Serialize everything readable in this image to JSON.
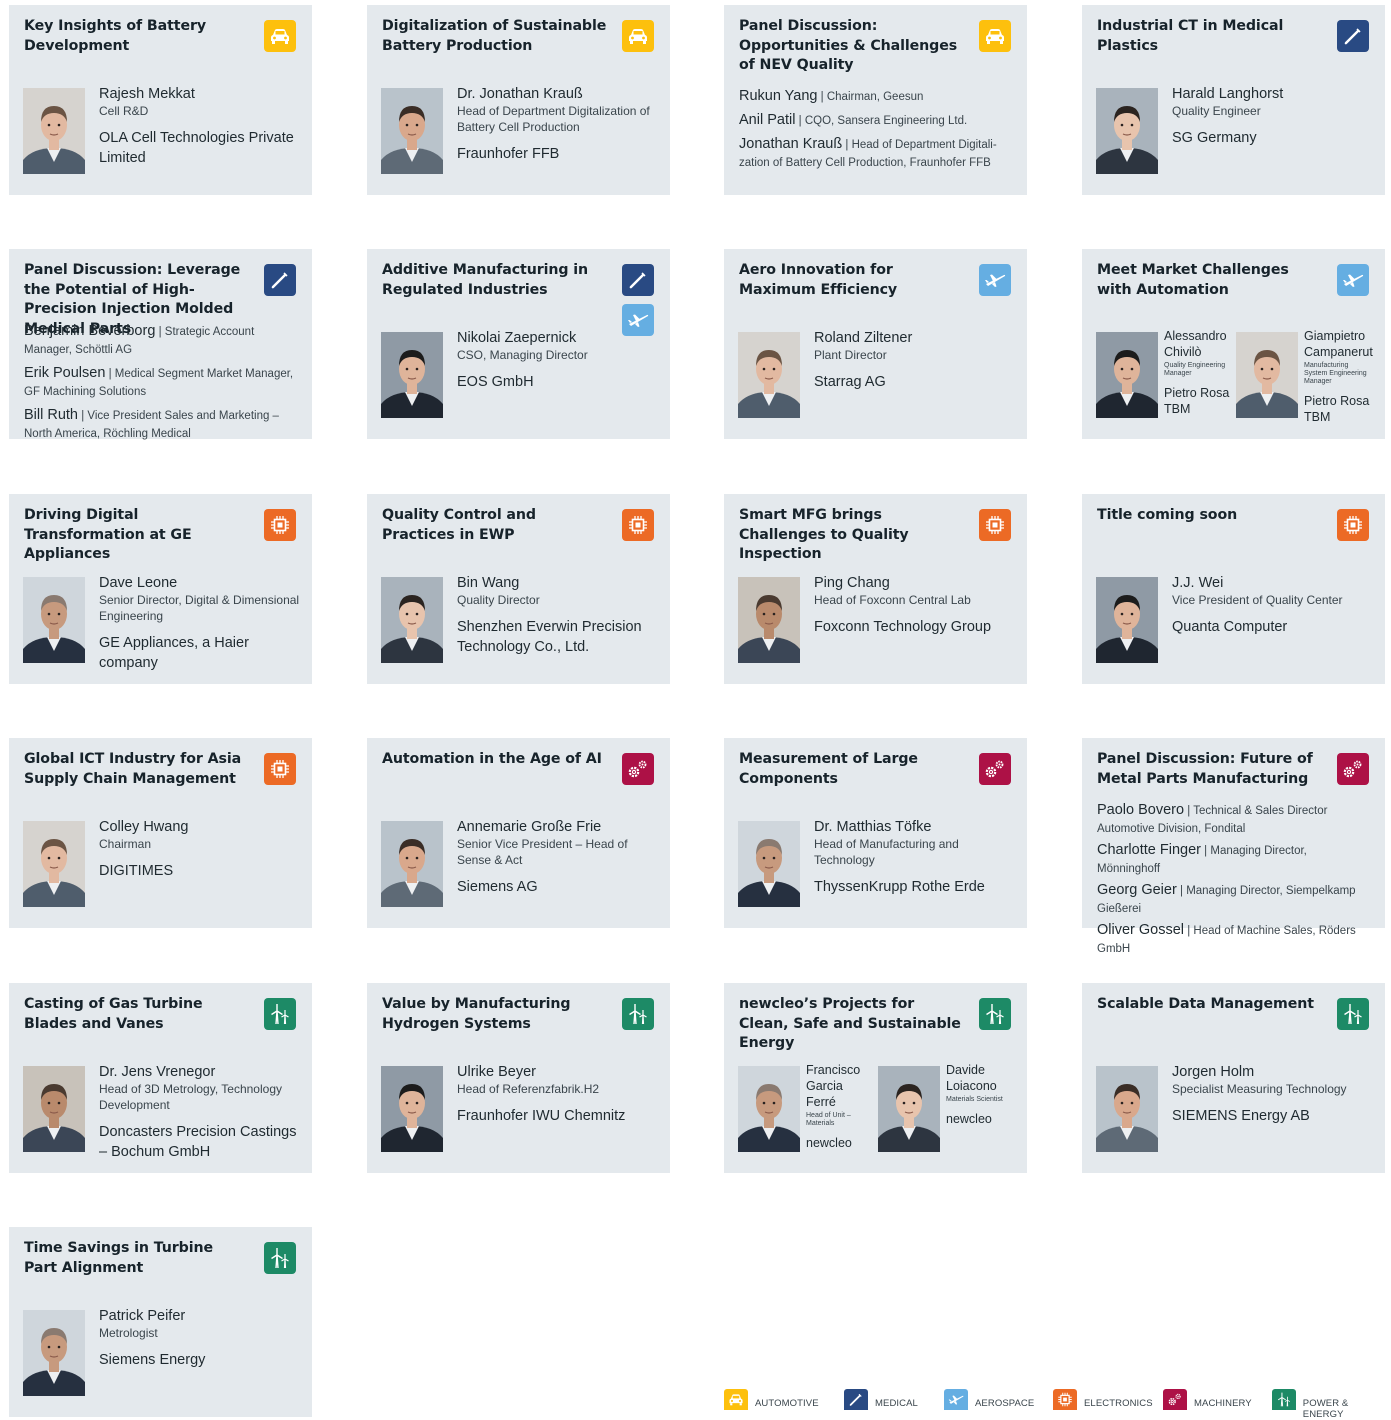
{
  "colors": {
    "automotive": "#fdc00d",
    "medical": "#294a83",
    "aerospace": "#65aee2",
    "electronics": "#ec6a25",
    "machinery": "#ad1146",
    "energy": "#1d8a66",
    "card_bg": "#e4e9ed"
  },
  "cards": [
    {
      "title": "Key Insights of Battery Development",
      "icons": [
        "automotive"
      ],
      "name": "Rajesh Mekkat",
      "role": "Cell R&D",
      "org": "OLA Cell Technologies Private Limited"
    },
    {
      "title": "Digitalization of Sustainable Battery Production",
      "icons": [
        "automotive"
      ],
      "name": "Dr. Jonathan Krauß",
      "role": "Head of Department Digitalization of Battery Cell Production",
      "org": "Fraunhofer FFB"
    },
    {
      "title": "Panel Discussion: Opportunities & Challenges of NEV Quality",
      "icons": [
        "automotive"
      ],
      "panel": [
        {
          "name": "Rukun Yang",
          "role": "Chairman, Geesun"
        },
        {
          "name": "Anil Patil",
          "role": "CQO, Sansera Engineering Ltd."
        },
        {
          "name": "Jonathan Krauß",
          "role": "Head of Department Digitali-zation of Battery Cell Production, Fraunhofer FFB"
        }
      ]
    },
    {
      "title": "Industrial CT in Medical Plastics",
      "icons": [
        "medical"
      ],
      "name": "Harald Langhorst",
      "role": "Quality Engineer",
      "org": "SG Germany"
    },
    {
      "title": "Panel Discussion: Leverage the Potential of High-Precision Injection Molded Medical Parts",
      "icons": [
        "medical"
      ],
      "panel": [
        {
          "name": "Benjamin Beverborg",
          "role": "Strategic Account Manager, Schöttli AG"
        },
        {
          "name": "Erik Poulsen",
          "role": "Medical Segment Market Manager, GF Machining Solutions"
        },
        {
          "name": "Bill Ruth",
          "role": "Vice President Sales and Marketing – North America, Röchling Medical"
        }
      ]
    },
    {
      "title": "Additive Manufacturing in Regulated Industries",
      "icons": [
        "medical",
        "aerospace"
      ],
      "name": "Nikolai Zaepernick",
      "role": "CSO, Managing Director",
      "org": "EOS GmbH"
    },
    {
      "title": "Aero Innovation for Maximum Efficiency",
      "icons": [
        "aerospace"
      ],
      "name": "Roland Ziltener",
      "role": "Plant Director",
      "org": "Starrag AG"
    },
    {
      "title": "Meet Market Challenges with Automation",
      "icons": [
        "aerospace"
      ],
      "duo": [
        {
          "name": "Alessandro Chivilò",
          "role": "Quality Engineering Manager",
          "org": "Pietro Rosa TBM"
        },
        {
          "name": "Giampietro Campanerut",
          "role": "Manufacturing System Engineering Manager",
          "org": "Pietro Rosa TBM"
        }
      ]
    },
    {
      "title": "Driving Digital Transformation at GE Appliances",
      "icons": [
        "electronics"
      ],
      "name": "Dave Leone",
      "role": "Senior Director, Digital & Dimensional Engineering",
      "org": "GE Appliances, a Haier company"
    },
    {
      "title": "Quality Control and Practices in EWP",
      "icons": [
        "electronics"
      ],
      "name": "Bin Wang",
      "role": "Quality Director",
      "org": "Shenzhen Everwin Precision Technology Co., Ltd."
    },
    {
      "title": "Smart MFG brings Challenges to Quality Inspection",
      "icons": [
        "electronics"
      ],
      "name": "Ping Chang",
      "role": "Head of Foxconn Central Lab",
      "org": "Foxconn Technology Group"
    },
    {
      "title": "Title coming soon",
      "icons": [
        "electronics"
      ],
      "name": "J.J. Wei",
      "role": "Vice President of Quality Center",
      "org": "Quanta Computer"
    },
    {
      "title": "Global ICT Industry for Asia Supply Chain Management",
      "icons": [
        "electronics"
      ],
      "name": "Colley Hwang",
      "role": "Chairman",
      "org": "DIGITIMES"
    },
    {
      "title": "Automation in the Age of AI",
      "icons": [
        "machinery"
      ],
      "name": "Annemarie Große Frie",
      "role": "Senior Vice President – Head of Sense & Act",
      "org": "Siemens AG"
    },
    {
      "title": "Measurement of Large Components",
      "icons": [
        "machinery"
      ],
      "name": "Dr. Matthias Töfke",
      "role": "Head of Manufacturing and Technology",
      "org": "ThyssenKrupp Rothe Erde"
    },
    {
      "title": "Panel Discussion: Future of Metal Parts Manufacturing",
      "icons": [
        "machinery"
      ],
      "panel": [
        {
          "name": "Paolo Bovero",
          "role": "Technical & Sales Director Automotive Division, Fondital"
        },
        {
          "name": "Charlotte Finger",
          "role": "Managing Director, Mönninghoff"
        },
        {
          "name": "Georg Geier",
          "role": "Managing Director, Siempelkamp Gießerei"
        },
        {
          "name": "Oliver Gossel",
          "role": "Head of Machine Sales, Röders GmbH"
        }
      ]
    },
    {
      "title": "Casting of Gas Turbine Blades and Vanes",
      "icons": [
        "energy"
      ],
      "name": "Dr. Jens Vrenegor",
      "role": "Head of 3D Metrology, Technology Development",
      "org": "Doncasters Precision Castings – Bochum GmbH"
    },
    {
      "title": "Value by Manufacturing Hydrogen Systems",
      "icons": [
        "energy"
      ],
      "name": "Ulrike Beyer",
      "role": "Head of Referenzfabrik.H2",
      "org": "Fraunhofer IWU Chemnitz"
    },
    {
      "title": "newcleo’s Projects for Clean, Safe and Sustainable Energy",
      "icons": [
        "energy"
      ],
      "duo": [
        {
          "name": "Francisco Garcia Ferré",
          "role": "Head of Unit – Materials",
          "org": "newcleo"
        },
        {
          "name": "Davide Loiacono",
          "role": "Materials Scientist",
          "org": "newcleo"
        }
      ]
    },
    {
      "title": "Scalable Data Management",
      "icons": [
        "energy"
      ],
      "name": "Jorgen Holm",
      "role": "Specialist Measuring Technology",
      "org": "SIEMENS Energy AB"
    },
    {
      "title": "Time Savings in Turbine Part Alignment",
      "icons": [
        "energy"
      ],
      "name": "Patrick Peifer",
      "role": "Metrologist",
      "org": "Siemens Energy"
    }
  ],
  "legend": [
    {
      "key": "automotive",
      "label": "AUTOMOTIVE"
    },
    {
      "key": "medical",
      "label": "MEDICAL"
    },
    {
      "key": "aerospace",
      "label": "AEROSPACE"
    },
    {
      "key": "electronics",
      "label": "ELECTRONICS"
    },
    {
      "key": "machinery",
      "label": "MACHINERY"
    },
    {
      "key": "energy",
      "label": "POWER & ENERGY"
    }
  ]
}
